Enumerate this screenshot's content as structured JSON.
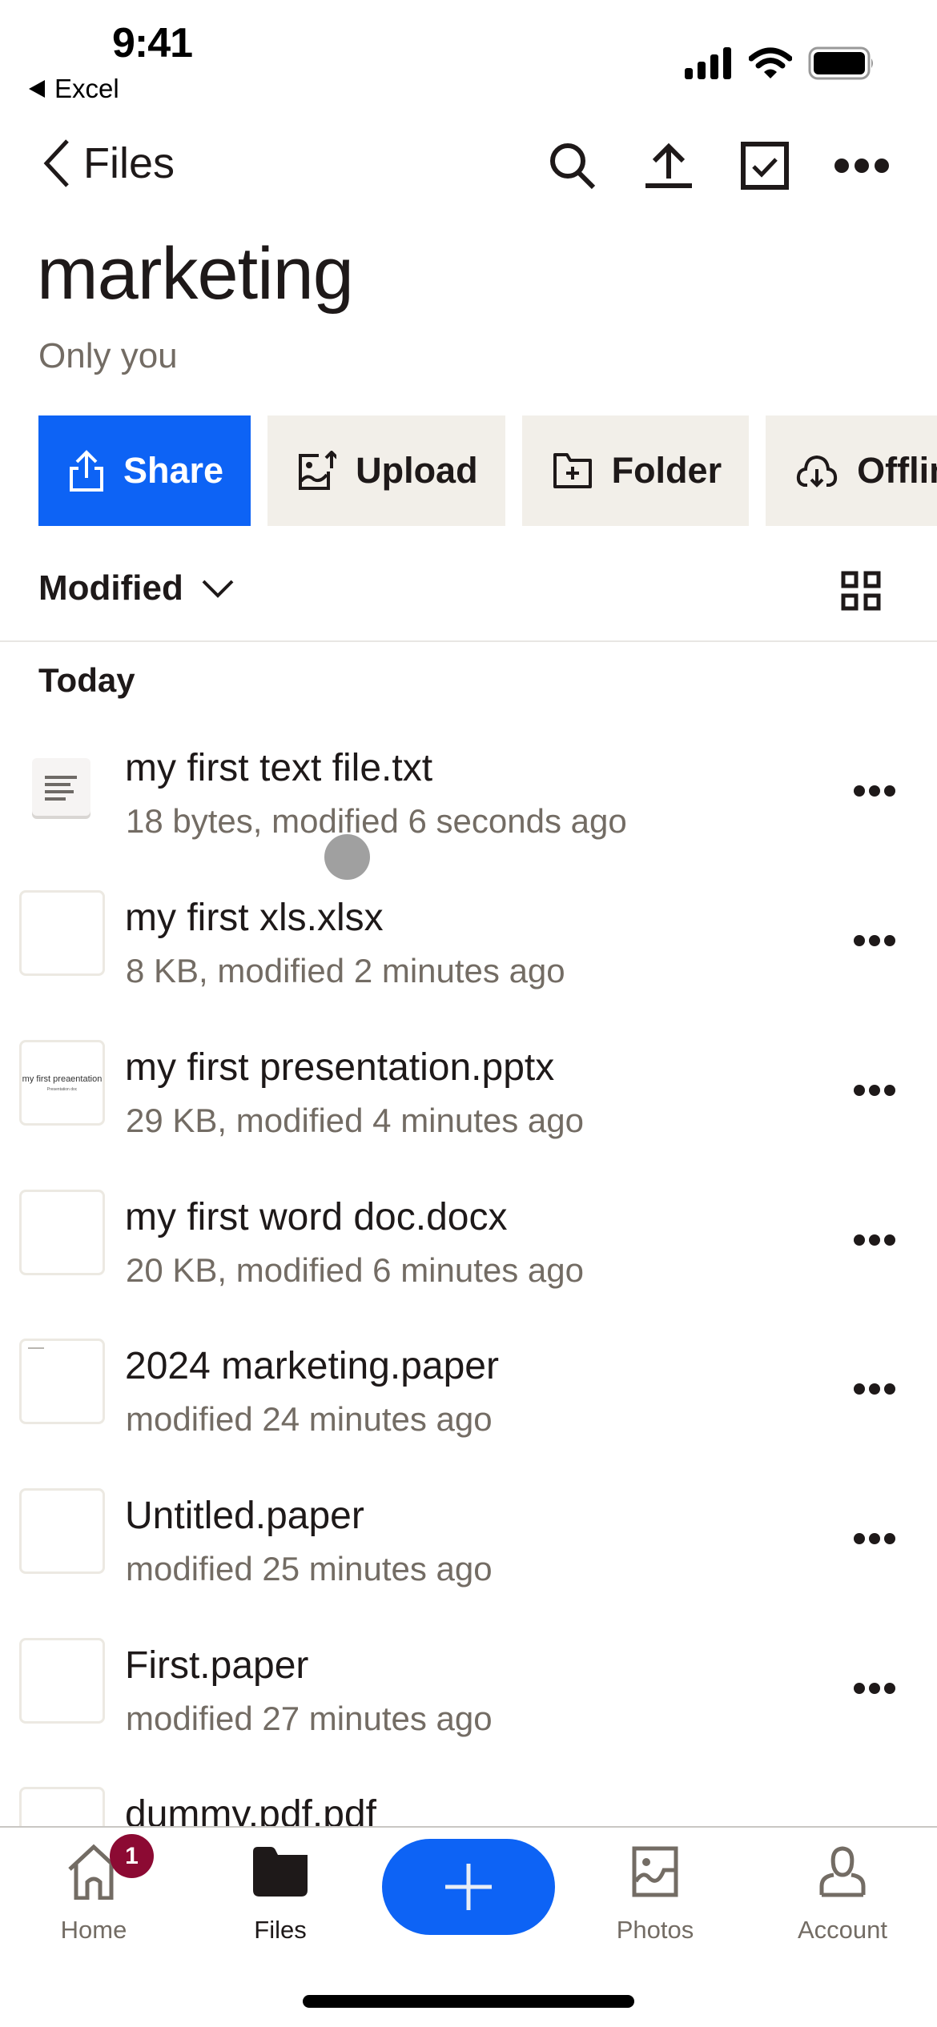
{
  "status_bar": {
    "time": "9:41",
    "back_app": "Excel",
    "icons": [
      "cellular-signal-icon",
      "wifi-icon",
      "battery-icon"
    ]
  },
  "nav": {
    "back_label": "Files",
    "actions": [
      {
        "name": "search",
        "icon": "search-icon"
      },
      {
        "name": "upload",
        "icon": "upload-icon"
      },
      {
        "name": "select",
        "icon": "checkbox-icon"
      },
      {
        "name": "more",
        "icon": "more-horizontal-icon"
      }
    ]
  },
  "folder": {
    "title": "marketing",
    "subtitle": "Only you"
  },
  "actions": [
    {
      "label": "Share",
      "icon": "share-icon",
      "primary": true
    },
    {
      "label": "Upload",
      "icon": "upload-photo-icon"
    },
    {
      "label": "Folder",
      "icon": "new-folder-icon"
    },
    {
      "label": "Offline",
      "icon": "cloud-download-icon"
    }
  ],
  "sort": {
    "label": "Modified",
    "view_toggle_icon": "grid-view-icon"
  },
  "section": {
    "label": "Today"
  },
  "files": [
    {
      "name": "my first text file.txt",
      "meta": "18 bytes, modified 6 seconds ago",
      "thumb": "txt"
    },
    {
      "name": "my first xls.xlsx",
      "meta": "8 KB, modified 2 minutes ago",
      "thumb": "blank"
    },
    {
      "name": "my first presentation.pptx",
      "meta": "29 KB, modified 4 minutes ago",
      "thumb": "pptx",
      "thumb_title": "my first preaentation",
      "thumb_sub": "Presentation doc"
    },
    {
      "name": "my first word doc.docx",
      "meta": "20 KB, modified 6 minutes ago",
      "thumb": "blank"
    },
    {
      "name": "2024 marketing.paper",
      "meta": "modified 24 minutes ago",
      "thumb": "paper"
    },
    {
      "name": "Untitled.paper",
      "meta": "modified 25 minutes ago",
      "thumb": "blank"
    },
    {
      "name": "First.paper",
      "meta": "modified 27 minutes ago",
      "thumb": "blank"
    },
    {
      "name": "dummy.pdf.pdf",
      "meta": "",
      "thumb": "blank"
    }
  ],
  "tab_bar": {
    "tabs": [
      {
        "label": "Home",
        "icon": "home-icon",
        "badge": "1"
      },
      {
        "label": "Files",
        "icon": "folder-icon",
        "active": true
      },
      {
        "label": "Photos",
        "icon": "photo-icon"
      },
      {
        "label": "Account",
        "icon": "account-icon"
      }
    ],
    "fab_icon": "plus-icon"
  },
  "colors": {
    "primary": "#0d63f5",
    "secondary_button": "#f2efe9",
    "badge": "#8c0a33",
    "text": "#1e1919",
    "muted_text": "#736c64"
  }
}
